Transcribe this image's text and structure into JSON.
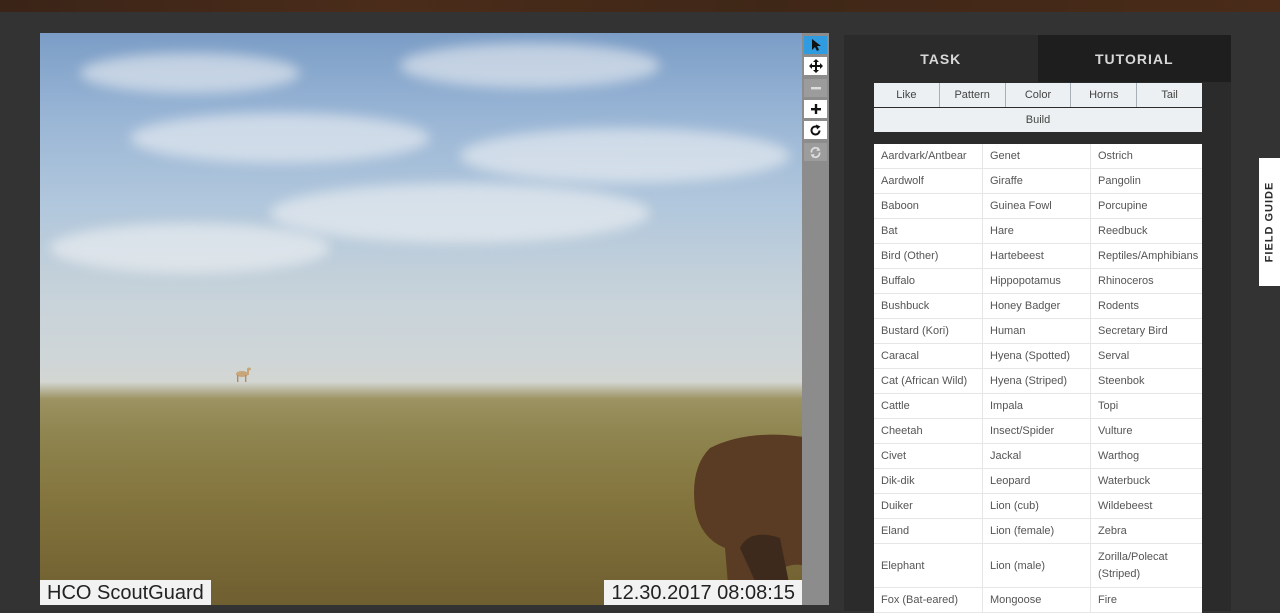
{
  "photo": {
    "camera_label": "HCO ScoutGuard",
    "timestamp": "12.30.2017 08:08:15"
  },
  "toolbar": {
    "tools": [
      {
        "name": "pointer-icon",
        "state": "active"
      },
      {
        "name": "move-icon",
        "state": "normal"
      },
      {
        "name": "zoom-out-icon",
        "state": "disabled"
      },
      {
        "name": "zoom-in-icon",
        "state": "normal"
      },
      {
        "name": "rotate-icon",
        "state": "normal"
      },
      {
        "name": "reset-icon",
        "state": "disabled"
      }
    ]
  },
  "panel": {
    "tabs": [
      "TASK",
      "TUTORIAL"
    ],
    "filters": [
      "Like",
      "Pattern",
      "Color",
      "Horns",
      "Tail"
    ],
    "build_label": "Build",
    "species": [
      [
        "Aardvark/Antbear",
        "Genet",
        "Ostrich"
      ],
      [
        "Aardwolf",
        "Giraffe",
        "Pangolin"
      ],
      [
        "Baboon",
        "Guinea Fowl",
        "Porcupine"
      ],
      [
        "Bat",
        "Hare",
        "Reedbuck"
      ],
      [
        "Bird (Other)",
        "Hartebeest",
        "Reptiles/Amphibians"
      ],
      [
        "Buffalo",
        "Hippopotamus",
        "Rhinoceros"
      ],
      [
        "Bushbuck",
        "Honey Badger",
        "Rodents"
      ],
      [
        "Bustard (Kori)",
        "Human",
        "Secretary Bird"
      ],
      [
        "Caracal",
        "Hyena (Spotted)",
        "Serval"
      ],
      [
        "Cat (African Wild)",
        "Hyena (Striped)",
        "Steenbok"
      ],
      [
        "Cattle",
        "Impala",
        "Topi"
      ],
      [
        "Cheetah",
        "Insect/Spider",
        "Vulture"
      ],
      [
        "Civet",
        "Jackal",
        "Warthog"
      ],
      [
        "Dik-dik",
        "Leopard",
        "Waterbuck"
      ],
      [
        "Duiker",
        "Lion (cub)",
        "Wildebeest"
      ],
      [
        "Eland",
        "Lion (female)",
        "Zebra"
      ],
      [
        "Elephant",
        "Lion (male)",
        "Zorilla/Polecat (Striped)"
      ],
      [
        "Fox (Bat-eared)",
        "Mongoose",
        "Fire"
      ]
    ]
  },
  "field_guide_label": "FIELD GUIDE",
  "colors": {
    "background": "#333333",
    "panel": "#2b2b2b",
    "tab_inactive": "#1e1e1e",
    "tool_active": "#2f9be0",
    "toolbar": "#8c8c8c"
  }
}
